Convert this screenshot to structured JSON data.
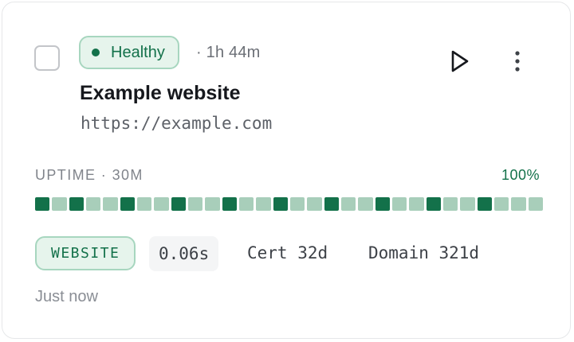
{
  "status": {
    "label": "Healthy",
    "color": "#13714a",
    "badge_bg": "#e6f4ec",
    "badge_border": "#a7d6bf"
  },
  "duration": "· 1h 44m",
  "site": {
    "name": "Example website",
    "url": "https://example.com"
  },
  "actions": {
    "play_icon": "play-icon",
    "more_icon": "more-vertical-icon"
  },
  "uptime": {
    "label": "UPTIME · 30M",
    "percent": "100%",
    "bars": [
      "dark",
      "light",
      "dark",
      "light",
      "light",
      "dark",
      "light",
      "light",
      "dark",
      "light",
      "light",
      "dark",
      "light",
      "light",
      "dark",
      "light",
      "light",
      "dark",
      "light",
      "light",
      "dark",
      "light",
      "light",
      "dark",
      "light",
      "light",
      "dark",
      "light",
      "light",
      "light"
    ],
    "dark_color": "#13714a",
    "light_color": "#a8ceba"
  },
  "meta": {
    "type": "WEBSITE",
    "response_time": "0.06s",
    "cert": "Cert 32d",
    "domain": "Domain 321d"
  },
  "last_checked": "Just now"
}
